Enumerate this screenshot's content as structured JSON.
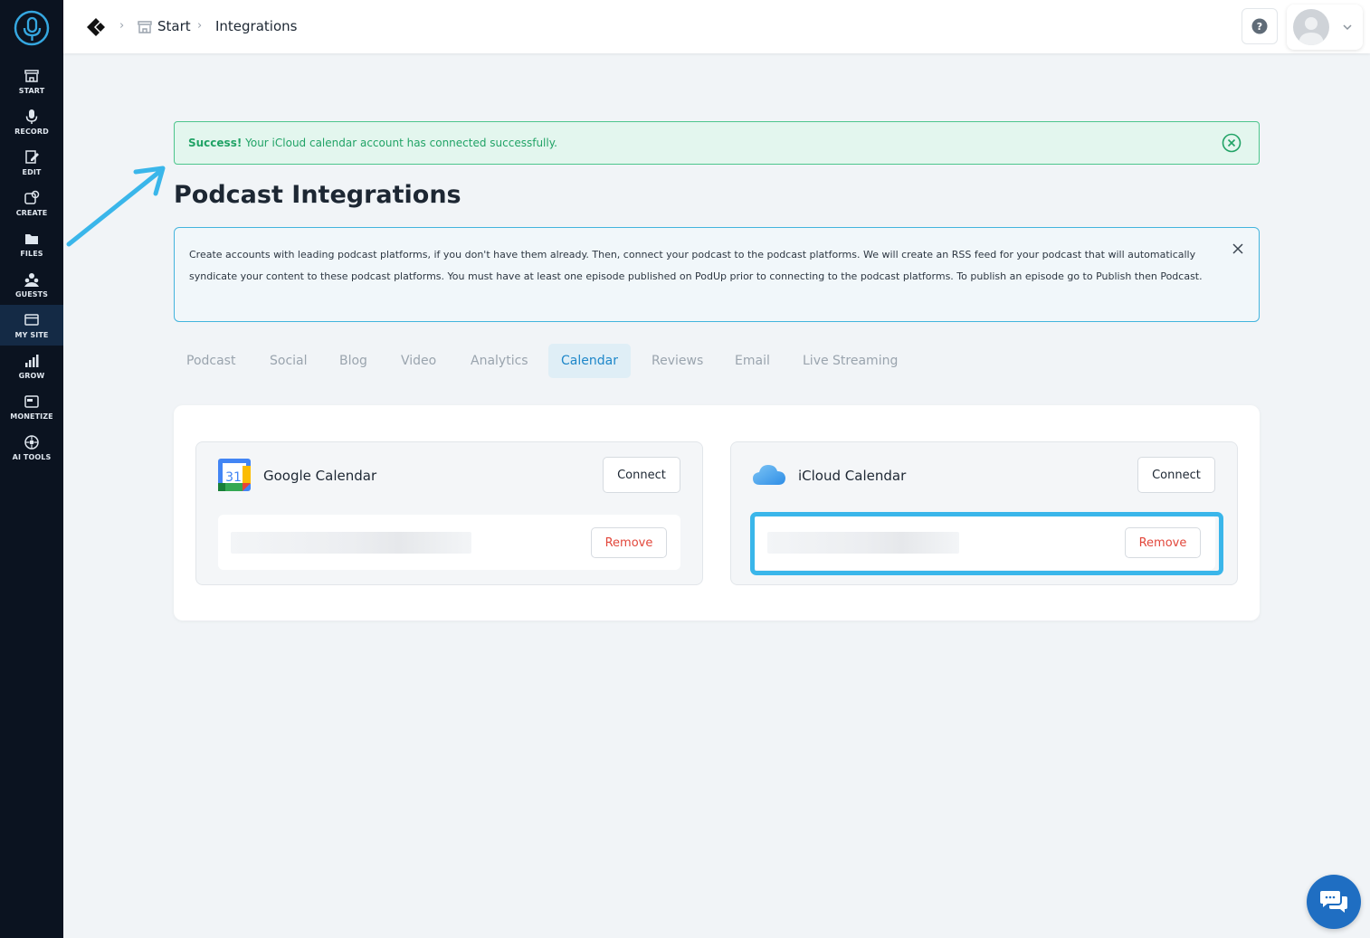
{
  "sidebar": {
    "items": [
      {
        "label": "START",
        "icon": "store-icon"
      },
      {
        "label": "RECORD",
        "icon": "microphone-icon"
      },
      {
        "label": "EDIT",
        "icon": "edit-icon"
      },
      {
        "label": "CREATE",
        "icon": "create-icon"
      },
      {
        "label": "FILES",
        "icon": "files-icon"
      },
      {
        "label": "GUESTS",
        "icon": "guests-icon"
      },
      {
        "label": "MY SITE",
        "icon": "site-icon",
        "active": true
      },
      {
        "label": "GROW",
        "icon": "chart-icon"
      },
      {
        "label": "MONETIZE",
        "icon": "monetize-icon"
      },
      {
        "label": "AI TOOLS",
        "icon": "ai-icon"
      }
    ]
  },
  "header": {
    "breadcrumbs": [
      "Start",
      "Integrations"
    ]
  },
  "alert": {
    "strong": "Success!",
    "message": " Your iCloud calendar account has connected successfully."
  },
  "page": {
    "title": "Podcast Integrations",
    "info": "Create accounts with leading podcast platforms, if you don't have them already. Then, connect your podcast to the podcast platforms. We will create an RSS feed for your podcast that will automatically syndicate your content to these podcast platforms. You must have at least one episode published on PodUp prior to connecting to the podcast platforms. To publish an episode go to Publish then Podcast."
  },
  "tabs": [
    {
      "label": "Podcast"
    },
    {
      "label": "Social"
    },
    {
      "label": "Blog"
    },
    {
      "label": "Video"
    },
    {
      "label": "Analytics"
    },
    {
      "label": "Calendar",
      "active": true
    },
    {
      "label": "Reviews"
    },
    {
      "label": "Email"
    },
    {
      "label": "Live Streaming"
    }
  ],
  "cards": [
    {
      "name": "Google Calendar",
      "connect_label": "Connect",
      "remove_label": "Remove"
    },
    {
      "name": "iCloud Calendar",
      "connect_label": "Connect",
      "remove_label": "Remove"
    }
  ],
  "colors": {
    "sidebar_bg": "#0b1320",
    "accent": "#1e87c9",
    "success": "#21a366",
    "highlight": "#3ab6ea",
    "danger": "#e2473b"
  }
}
